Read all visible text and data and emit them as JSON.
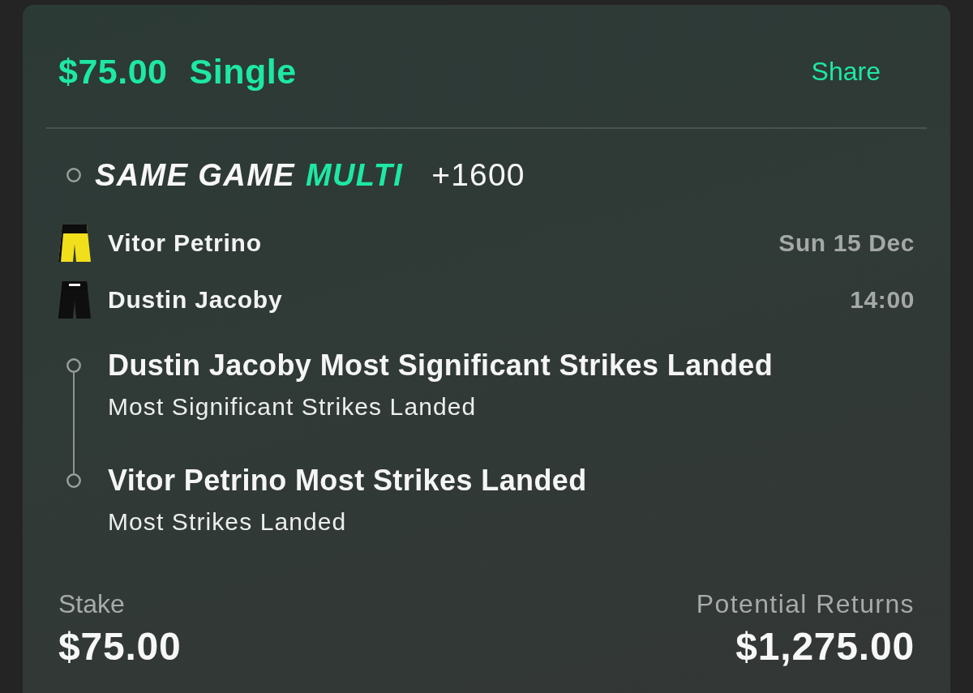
{
  "header": {
    "stake_amount": "$75.00",
    "bet_type": "Single",
    "share_label": "Share"
  },
  "multi": {
    "label_parts": [
      {
        "text": "SAME GAME",
        "accent": false
      },
      {
        "text": "MULTI",
        "accent": true
      }
    ],
    "odds": "+1600"
  },
  "event": {
    "date": "Sun 15 Dec",
    "time": "14:00",
    "competitors": [
      {
        "name": "Vitor Petrino",
        "color": "#f2df1c",
        "waistband_stripe": false
      },
      {
        "name": "Dustin Jacoby",
        "color": "#0f0f0f",
        "waistband_stripe": true
      }
    ]
  },
  "selections": [
    {
      "title": "Dustin Jacoby Most Significant Strikes Landed",
      "market": "Most Significant Strikes Landed"
    },
    {
      "title": "Vitor Petrino Most Strikes Landed",
      "market": "Most Strikes Landed"
    }
  ],
  "summary": {
    "stake_label": "Stake",
    "stake": "$75.00",
    "returns_label": "Potential Returns",
    "returns": "$1,275.00"
  }
}
